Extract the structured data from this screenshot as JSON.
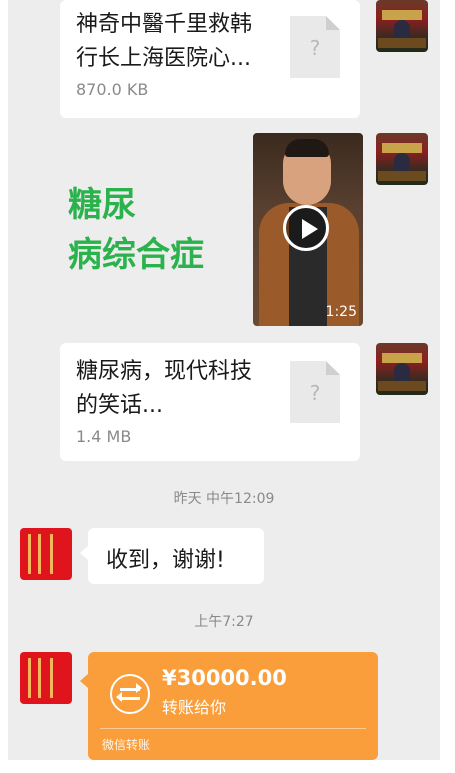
{
  "messages": {
    "file1": {
      "title_line1": "神奇中醫千里救韩",
      "title_line2": "行长上海医院心...",
      "size": "870.0 KB",
      "file_icon_glyph": "?"
    },
    "video": {
      "overlay_line1": "糖尿",
      "overlay_line2": "病综合症",
      "duration": "1:25"
    },
    "file2": {
      "title_line1": "糖尿病，现代科技",
      "title_line2": "的笑话...",
      "size": "1.4 MB",
      "file_icon_glyph": "?"
    },
    "timestamp1": "昨天 中午12:09",
    "reply": {
      "text": "收到，谢谢!"
    },
    "timestamp2": "上午7:27",
    "transfer": {
      "amount": "¥30000.00",
      "caption": "转账给你",
      "footer": "微信转账"
    }
  },
  "colors": {
    "chat_background": "#ededed",
    "bubble": "#ffffff",
    "green_overlay_text": "#2bb24c",
    "transfer_orange": "#fa9d3b",
    "timestamp_gray": "#8a8a8a"
  },
  "icons": [
    "file-icon",
    "play-icon",
    "transfer-icon",
    "avatar-image"
  ]
}
